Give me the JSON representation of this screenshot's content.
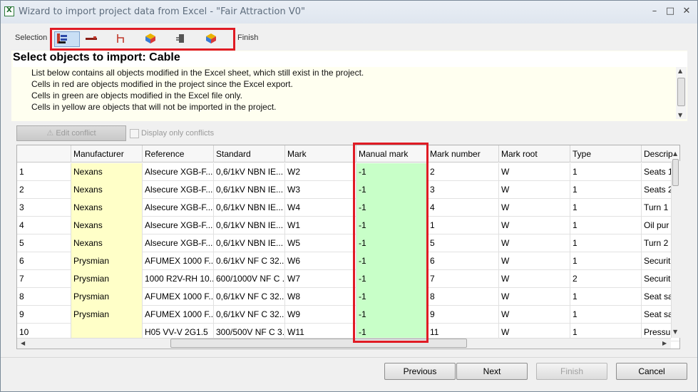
{
  "window": {
    "title": "Wizard to import project data from Excel - \"Fair Attraction V0\"",
    "minimize": "–",
    "maximize": "□",
    "close": "✕"
  },
  "steps": {
    "selection_label": "Selection",
    "finish_label": "Finish",
    "icons": [
      "cable-import-icon",
      "cable-icon",
      "wire-icon",
      "cube-icon",
      "plug-icon",
      "cube-icon"
    ]
  },
  "header": {
    "title": "Select objects to import: Cable",
    "lines": [
      "List below contains all objects modified in the Excel sheet, which still exist in the project.",
      "Cells in red are objects modified in the project since the Excel export.",
      "Cells in green are objects modified in the Excel file only.",
      "Cells in yellow are objects that will not be imported in the project."
    ]
  },
  "toolbar": {
    "edit_conflict": "Edit conflict",
    "display_only_conflicts": "Display only conflicts"
  },
  "grid": {
    "columns": [
      "",
      "Manufacturer",
      "Reference",
      "Standard",
      "Mark",
      "Manual mark",
      "Mark number",
      "Mark root",
      "Type",
      "Descrip"
    ],
    "rows": [
      [
        "1",
        "Nexans",
        "Alsecure XGB-F...",
        "0,6/1kV NBN IE...",
        "W2",
        "-1",
        "2",
        "W",
        "1",
        "Seats 1"
      ],
      [
        "2",
        "Nexans",
        "Alsecure XGB-F...",
        "0,6/1kV NBN IE...",
        "W3",
        "-1",
        "3",
        "W",
        "1",
        "Seats 2"
      ],
      [
        "3",
        "Nexans",
        "Alsecure XGB-F...",
        "0,6/1kV NBN IE...",
        "W4",
        "-1",
        "4",
        "W",
        "1",
        "Turn 1"
      ],
      [
        "4",
        "Nexans",
        "Alsecure XGB-F...",
        "0,6/1kV NBN IE...",
        "W1",
        "-1",
        "1",
        "W",
        "1",
        "Oil pur"
      ],
      [
        "5",
        "Nexans",
        "Alsecure XGB-F...",
        "0,6/1kV NBN IE...",
        "W5",
        "-1",
        "5",
        "W",
        "1",
        "Turn 2"
      ],
      [
        "6",
        "Prysmian",
        "AFUMEX 1000 F...",
        "0.6/1kV NF C 32...",
        "W6",
        "-1",
        "6",
        "W",
        "1",
        "Securit"
      ],
      [
        "7",
        "Prysmian",
        "1000 R2V-RH 10...",
        "600/1000V NF C ...",
        "W7",
        "-1",
        "7",
        "W",
        "2",
        "Securit"
      ],
      [
        "8",
        "Prysmian",
        "AFUMEX 1000 F...",
        "0,6/1kV NF C 32...",
        "W8",
        "-1",
        "8",
        "W",
        "1",
        "Seat sa"
      ],
      [
        "9",
        "Prysmian",
        "AFUMEX 1000 F...",
        "0,6/1kV NF C 32...",
        "W9",
        "-1",
        "9",
        "W",
        "1",
        "Seat sa"
      ],
      [
        "10",
        "",
        "H05 VV-V 2G1.5",
        "300/500V NF C 3...",
        "W11",
        "-1",
        "11",
        "W",
        "1",
        "Pressur"
      ]
    ]
  },
  "footer": {
    "previous": "Previous",
    "next": "Next",
    "finish": "Finish",
    "cancel": "Cancel"
  },
  "colors": {
    "not_imported": "#ffffc8",
    "modified_excel_only": "#c8ffc8",
    "highlight": "#e01b24"
  }
}
